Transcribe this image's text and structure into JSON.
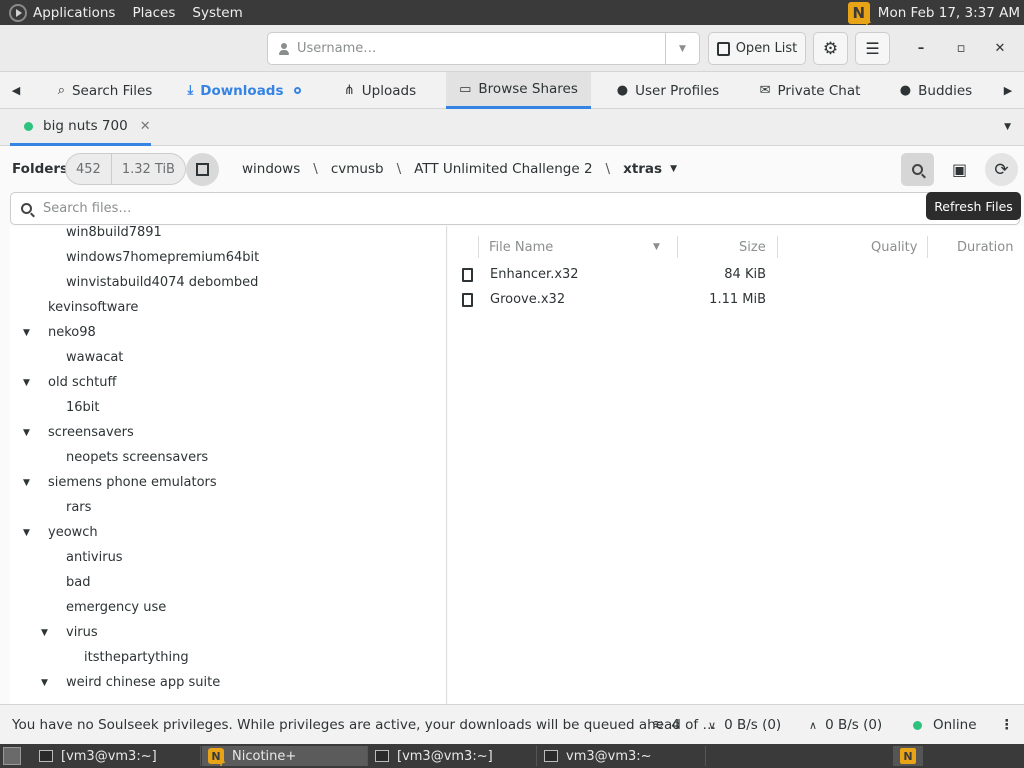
{
  "top_panel": {
    "menus": [
      "Applications",
      "Places",
      "System"
    ],
    "clock": "Mon Feb 17,  3:37 AM",
    "logo_glyph": "N"
  },
  "header": {
    "username_placeholder": "Username…",
    "open_list_label": "Open List",
    "settings_icon": "gear-icon",
    "menu_icon": "hamburger-icon",
    "minimize": "–",
    "maximize": "▫",
    "close": "✕"
  },
  "tabs": [
    {
      "label": "Search Files",
      "icon": "⌕"
    },
    {
      "label": "Downloads",
      "icon": "⤓"
    },
    {
      "label": "Uploads",
      "icon": "⋔"
    },
    {
      "label": "Browse Shares",
      "icon": "▭"
    },
    {
      "label": "User Profiles",
      "icon": "●"
    },
    {
      "label": "Private Chat",
      "icon": "✉"
    },
    {
      "label": "Buddies",
      "icon": "●"
    }
  ],
  "user_tab": {
    "name": "big nuts 700",
    "close": "✕"
  },
  "browse": {
    "folders_label": "Folders",
    "folder_count": "452",
    "total_size": "1.32 TiB",
    "breadcrumb": [
      "windows",
      "cvmusb",
      "ATT Unlimited Challenge 2",
      "xtras"
    ],
    "search_placeholder": "Search files…",
    "tooltip": "Refresh Files"
  },
  "tree": [
    {
      "label": "win8build7891",
      "level": 1,
      "expander": ""
    },
    {
      "label": "windows7homepremium64bit",
      "level": 1,
      "expander": ""
    },
    {
      "label": "winvistabuild4074 debombed",
      "level": 1,
      "expander": ""
    },
    {
      "label": "kevinsoftware",
      "level": 0,
      "expander": ""
    },
    {
      "label": "neko98",
      "level": 0,
      "expander": "▼"
    },
    {
      "label": "wawacat",
      "level": 1,
      "expander": ""
    },
    {
      "label": "old schtuff",
      "level": 0,
      "expander": "▼"
    },
    {
      "label": "16bit",
      "level": 1,
      "expander": ""
    },
    {
      "label": "screensavers",
      "level": 0,
      "expander": "▼"
    },
    {
      "label": "neopets screensavers",
      "level": 1,
      "expander": ""
    },
    {
      "label": "siemens phone emulators",
      "level": 0,
      "expander": "▼"
    },
    {
      "label": "rars",
      "level": 1,
      "expander": ""
    },
    {
      "label": "yeowch",
      "level": 0,
      "expander": "▼"
    },
    {
      "label": "antivirus",
      "level": 1,
      "expander": ""
    },
    {
      "label": "bad",
      "level": 1,
      "expander": ""
    },
    {
      "label": "emergency use",
      "level": 1,
      "expander": ""
    },
    {
      "label": "virus",
      "level": 1,
      "expander": "▼"
    },
    {
      "label": "itsthepartything",
      "level": 2,
      "expander": ""
    },
    {
      "label": "weird chinese app suite",
      "level": 1,
      "expander": "▼"
    }
  ],
  "file_columns": {
    "name": "File Name",
    "size": "Size",
    "quality": "Quality",
    "duration": "Duration"
  },
  "files": [
    {
      "name": "Enhancer.x32",
      "size": "84 KiB"
    },
    {
      "name": "Groove.x32",
      "size": "1.11 MiB"
    }
  ],
  "status": {
    "message": "You have no Soulseek privileges. While privileges are active, your downloads will be queued ahead of …",
    "connections": "4",
    "down_speed": "0 B/s (0)",
    "up_speed": "0 B/s (0)",
    "online": "Online"
  },
  "taskbar": [
    {
      "label": "[vm3@vm3:~]",
      "active": false
    },
    {
      "label": "Nicotine+",
      "active": true
    },
    {
      "label": "[vm3@vm3:~]",
      "active": false
    },
    {
      "label": "vm3@vm3:~",
      "active": false
    }
  ],
  "colors": {
    "accent": "#3584e4",
    "online": "#2ec27e",
    "panel": "#3a3a3a",
    "logo": "#e8a317"
  }
}
